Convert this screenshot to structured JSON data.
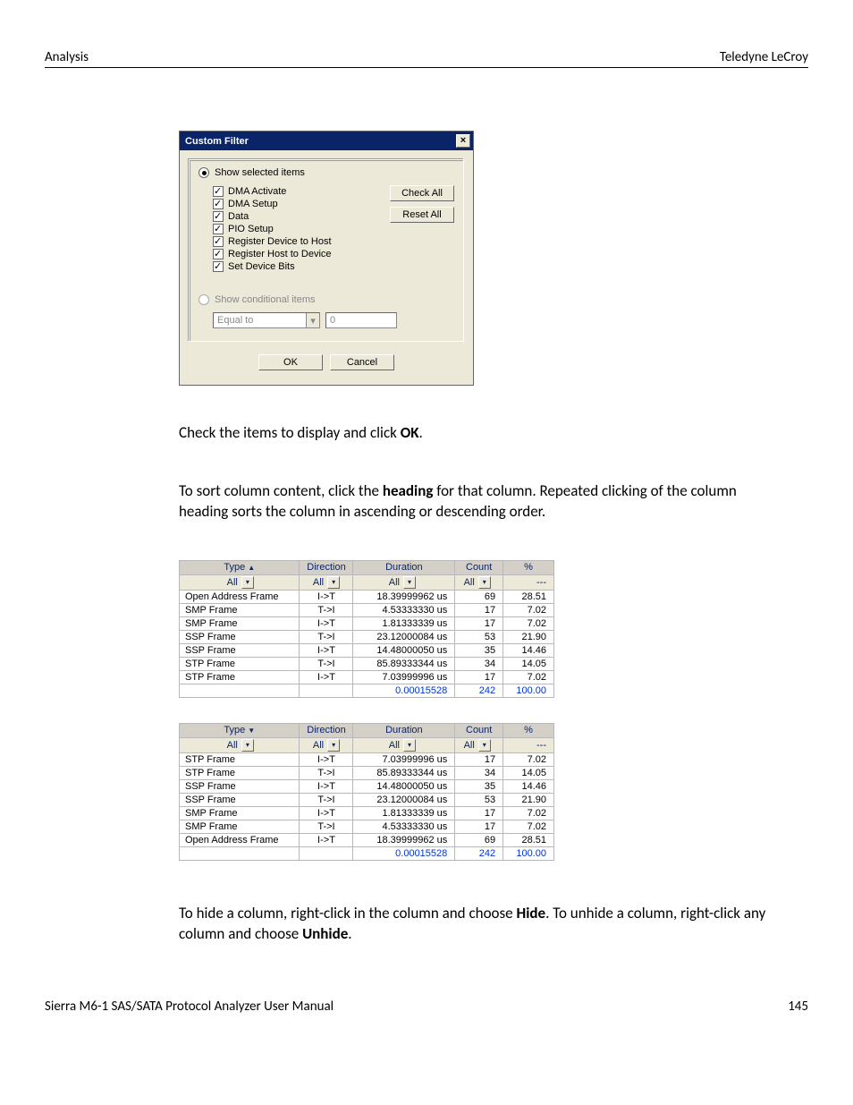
{
  "header": {
    "left": "Analysis",
    "right": "Teledyne LeCroy"
  },
  "dialog": {
    "title": "Custom Filter",
    "radio1": "Show selected items",
    "radio2": "Show conditional items",
    "check_all": "Check All",
    "reset_all": "Reset All",
    "items": [
      "DMA Activate",
      "DMA Setup",
      "Data",
      "PIO Setup",
      "Register Device to Host",
      "Register Host to Device",
      "Set Device Bits"
    ],
    "combo": "Equal to",
    "txtval": "0",
    "ok": "OK",
    "cancel": "Cancel"
  },
  "para1_a": "Check the items to display and click ",
  "para1_b": "OK",
  "para1_c": ".",
  "para2_a": "To sort column content, click the ",
  "para2_b": "heading",
  "para2_c": " for that column. Repeated clicking of the column heading sorts the column in ascending or descending order.",
  "table_headers": {
    "type": "Type",
    "direction": "Direction",
    "duration": "Duration",
    "count": "Count",
    "percent": "%"
  },
  "filter_all": "All",
  "filter_dash": "---",
  "table1": {
    "rows": [
      [
        "Open Address Frame",
        "I->T",
        "18.39999962 us",
        "69",
        "28.51"
      ],
      [
        "SMP Frame",
        "T->I",
        "4.53333330 us",
        "17",
        "7.02"
      ],
      [
        "SMP Frame",
        "I->T",
        "1.81333339 us",
        "17",
        "7.02"
      ],
      [
        "SSP Frame",
        "T->I",
        "23.12000084 us",
        "53",
        "21.90"
      ],
      [
        "SSP Frame",
        "I->T",
        "14.48000050 us",
        "35",
        "14.46"
      ],
      [
        "STP Frame",
        "T->I",
        "85.89333344 us",
        "34",
        "14.05"
      ],
      [
        "STP Frame",
        "I->T",
        "7.03999996 us",
        "17",
        "7.02"
      ]
    ],
    "totals": [
      "",
      "",
      "0.00015528",
      "242",
      "100.00"
    ]
  },
  "table2": {
    "rows": [
      [
        "STP Frame",
        "I->T",
        "7.03999996 us",
        "17",
        "7.02"
      ],
      [
        "STP Frame",
        "T->I",
        "85.89333344 us",
        "34",
        "14.05"
      ],
      [
        "SSP Frame",
        "I->T",
        "14.48000050 us",
        "35",
        "14.46"
      ],
      [
        "SSP Frame",
        "T->I",
        "23.12000084 us",
        "53",
        "21.90"
      ],
      [
        "SMP Frame",
        "I->T",
        "1.81333339 us",
        "17",
        "7.02"
      ],
      [
        "SMP Frame",
        "T->I",
        "4.53333330 us",
        "17",
        "7.02"
      ],
      [
        "Open Address Frame",
        "I->T",
        "18.39999962 us",
        "69",
        "28.51"
      ]
    ],
    "totals": [
      "",
      "",
      "0.00015528",
      "242",
      "100.00"
    ]
  },
  "para3_a": "To hide a column, right-click in the column and choose ",
  "para3_b": "Hide",
  "para3_c": ". To unhide a column, right-click any column and choose ",
  "para3_d": "Unhide",
  "para3_e": ".",
  "footer": {
    "left": "Sierra M6-1 SAS/SATA Protocol Analyzer User Manual",
    "right": "145"
  }
}
